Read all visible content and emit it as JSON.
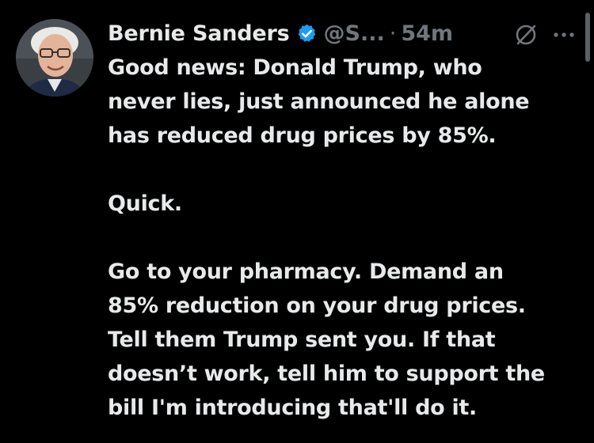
{
  "tweet": {
    "author_name": "Bernie Sanders",
    "handle": "@S...",
    "separator": "·",
    "time": "54m",
    "verified_color": "#1d9bf0",
    "icons": {
      "verified": "verified-badge-icon",
      "grok": "grok-icon",
      "more": "more-options-icon",
      "avatar": "avatar"
    },
    "body": {
      "p1": [
        "Good news: Donald Trump, who",
        "never lies, just announced he alone",
        "has reduced drug prices by 85%."
      ],
      "p2": [
        "Quick."
      ],
      "p3": [
        "Go to your pharmacy. Demand an",
        "85% reduction on your drug prices.",
        "Tell them Trump sent you. If that",
        "doesn’t work, tell him to support the",
        "bill I'm introducing that'll do it."
      ]
    }
  }
}
